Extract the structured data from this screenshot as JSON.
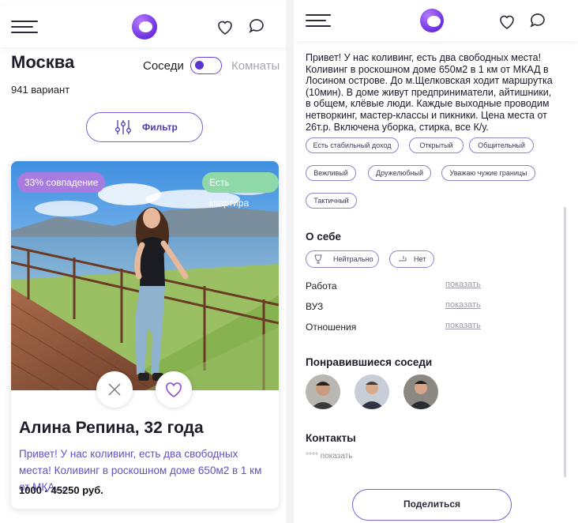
{
  "left": {
    "city": "Москва",
    "count": "941 вариант",
    "toggle_left": "Соседи",
    "toggle_right": "Комнаты",
    "filter_label": "Фильтр",
    "card": {
      "match_badge": "33% совпадение",
      "apartment_badge": "Есть квартира",
      "name": "Алина Репина, 32 года",
      "description": "Привет! У нас коливинг, есть два свободных места! Коливинг в роскошном доме 650м2 в 1 км от МКА…",
      "price": "1000 - 45250 руб."
    }
  },
  "right": {
    "description": "Привет! У нас коливинг, есть два свободных места! Коливинг в роскошном доме 650м2 в 1 км от МКАД в Лосином острове. До м.Щелковская ходит маршрутка (10мин). В доме живут предприниматели, айтишники, в общем, клёвые люди. Каждые выходные проводим нетворкинг, мастер-классы и пикники. Цена места от 26т.р. Включена уборка, стирка, все К/у.",
    "tags": [
      "Есть стабильный доход",
      "Открытый",
      "Общительный",
      "Вежливый",
      "Дружелюбный",
      "Уважаю чужие границы",
      "Тактичный"
    ],
    "about_title": "О себе",
    "about_chips": [
      "Нейтрально",
      "Нет"
    ],
    "rows": [
      {
        "label": "Работа",
        "action": "показать"
      },
      {
        "label": "ВУЗ",
        "action": "показать"
      },
      {
        "label": "Отношения",
        "action": "показать"
      }
    ],
    "liked_title": "Понравившиеся соседи",
    "contacts_title": "Контакты",
    "contacts_value": "°°°° показать",
    "share_label": "Поделиться"
  },
  "colors": {
    "accent": "#6b3ee0",
    "match_badge": "#a77be0",
    "apartment_badge": "#8fd9a8",
    "link": "#9a9aa8"
  }
}
